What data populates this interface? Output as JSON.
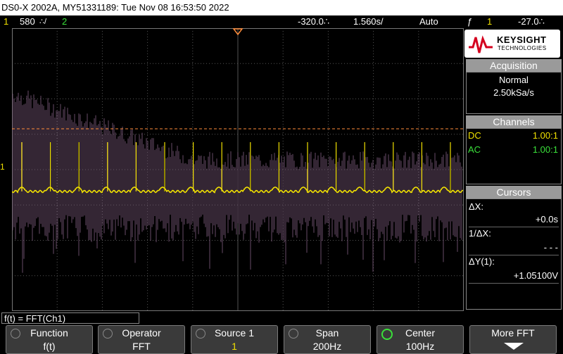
{
  "titlebar": {
    "text": "DS0-X 2002A, MY51331189: Tue Nov 08 16:53:50 2022"
  },
  "status": {
    "ch1_num": "1",
    "ch1_scale": "580",
    "ch1_unit": "∴/",
    "ch2_num": "2",
    "time_offset": "-320.0∴",
    "timebase": "1.560s/",
    "trigger_mode": "Auto",
    "trigger_icon": "ƒ",
    "trigger_source": "1",
    "trigger_level": "-27.0∴"
  },
  "logo": {
    "brand": "KEYSIGHT",
    "sub": "TECHNOLOGIES"
  },
  "acquisition": {
    "header": "Acquisition",
    "mode": "Normal",
    "rate": "2.50kSa/s"
  },
  "channels": {
    "header": "Channels",
    "rows": [
      {
        "coupling": "DC",
        "ratio": "1.00:1"
      },
      {
        "coupling": "AC",
        "ratio": "1.00:1"
      }
    ]
  },
  "cursors": {
    "header": "Cursors",
    "dx_label": "ΔX:",
    "dx_value": "+0.0s",
    "inv_dx_label": "1/ΔX:",
    "inv_dx_value": "- - -",
    "dy_label": "ΔY(1):",
    "dy_value": "+1.05100V"
  },
  "math_label": "f(t) = FFT(Ch1)",
  "left_marker": "1",
  "softkeys": [
    {
      "title": "Function",
      "value": "f(t)"
    },
    {
      "title": "Operator",
      "value": "FFT"
    },
    {
      "title": "Source 1",
      "value": "1"
    },
    {
      "title": "Span",
      "value": "200Hz"
    },
    {
      "title": "Center",
      "value": "100Hz"
    },
    {
      "title": "More FFT",
      "value": ""
    }
  ],
  "colors": {
    "ch1": "#f0e000",
    "ch2": "#3ae03a",
    "fft": "#7a5a7a",
    "grid": "#555555",
    "accent": "#ff8c3a"
  }
}
